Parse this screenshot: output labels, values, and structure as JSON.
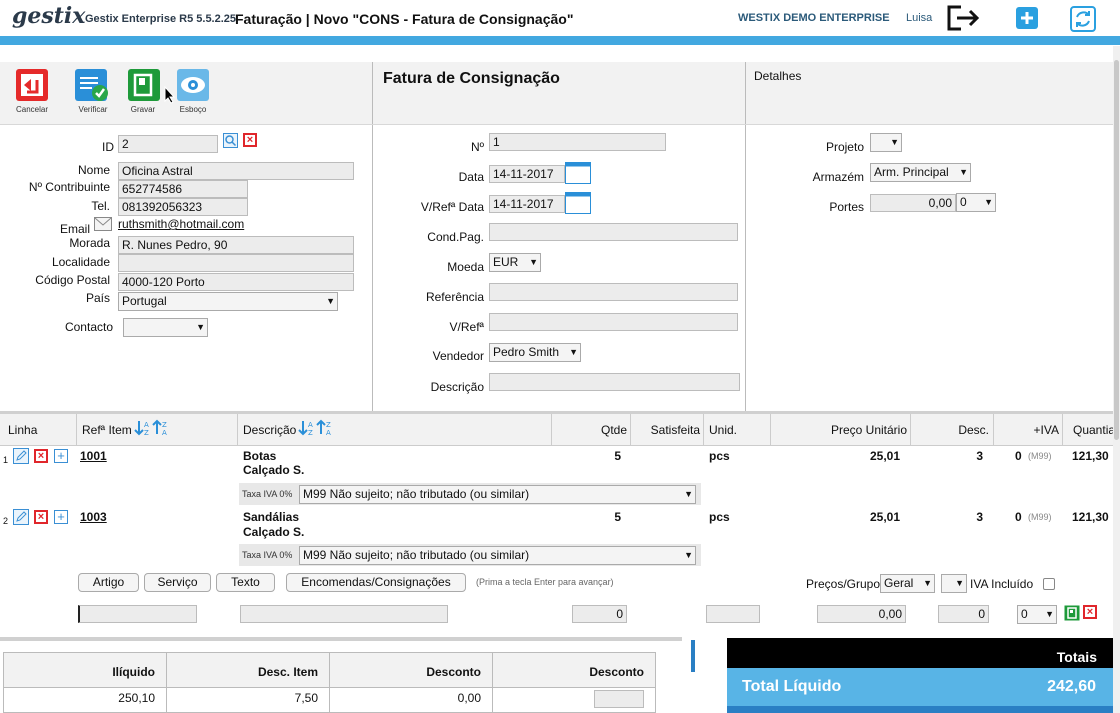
{
  "header": {
    "logo": "gestix",
    "version": "Gestix Enterprise R5 5.5.2.25",
    "title": "Faturação | Novo \"CONS - Fatura de Consignação\"",
    "company": "WESTIX DEMO ENTERPRISE",
    "user": "Luisa"
  },
  "toolbar": {
    "cancel": "Cancelar",
    "verify": "Verificar",
    "save": "Gravar",
    "draft": "Esboço"
  },
  "doc": {
    "title": "Fatura de Consignação",
    "details_title": "Detalhes"
  },
  "client": {
    "id_label": "ID",
    "id_value": "2",
    "name_label": "Nome",
    "name_value": "Oficina Astral",
    "nif_label": "Nº Contribuinte",
    "nif_value": "652774586",
    "phone_label": "Tel.",
    "phone_value": "081392056323",
    "email_label": "Email",
    "email_value": "ruthsmith@hotmail.com",
    "address_label": "Morada",
    "address_value": "R. Nunes Pedro, 90",
    "locality_label": "Localidade",
    "locality_value": "",
    "postal_label": "Código Postal",
    "postal_value": "4000-120 Porto",
    "country_label": "País",
    "country_value": "Portugal",
    "contact_label": "Contacto",
    "contact_value": ""
  },
  "invoice": {
    "number_label": "Nº",
    "number_value": "1",
    "date_label": "Data",
    "date_value": "14-11-2017",
    "ref_date_label": "V/Refª Data",
    "ref_date_value": "14-11-2017",
    "payment_label": "Cond.Pag.",
    "currency_label": "Moeda",
    "currency_value": "EUR",
    "reference_label": "Referência",
    "vref_label": "V/Refª",
    "seller_label": "Vendedor",
    "seller_value": "Pedro Smith",
    "description_label": "Descrição"
  },
  "details": {
    "project_label": "Projeto",
    "project_value": "",
    "warehouse_label": "Armazém",
    "warehouse_value": "Arm. Principal",
    "shipping_label": "Portes",
    "shipping_value": "0,00",
    "shipping_rate": "0"
  },
  "grid": {
    "headers": {
      "line": "Linha",
      "ref": "Refª Item",
      "desc": "Descrição",
      "qty": "Qtde",
      "satisfied": "Satisfeita",
      "unit": "Unid.",
      "price": "Preço Unitário",
      "discount": "Desc.",
      "vat": "+IVA",
      "amount": "Quantia"
    },
    "rows": [
      {
        "num": "1",
        "ref": "1001",
        "desc1": "Botas",
        "desc2": "Calçado S.",
        "qty": "5",
        "unit": "pcs",
        "price": "25,01",
        "discount": "3",
        "vat": "0",
        "vat_code": "(M99)",
        "amount": "121,30",
        "tax_label": "Taxa IVA 0%",
        "tax_value": "M99 Não sujeito; não tributado (ou similar)"
      },
      {
        "num": "2",
        "ref": "1003",
        "desc1": "Sandálias",
        "desc2": "Calçado S.",
        "qty": "5",
        "unit": "pcs",
        "price": "25,01",
        "discount": "3",
        "vat": "0",
        "vat_code": "(M99)",
        "amount": "121,30",
        "tax_label": "Taxa IVA 0%",
        "tax_value": "M99 Não sujeito; não tributado (ou similar)"
      }
    ],
    "buttons": {
      "article": "Artigo",
      "service": "Serviço",
      "text": "Texto",
      "orders": "Encomendas/Consignações",
      "hint": "(Prima a tecla Enter para avançar)"
    },
    "prices_group_label": "Preços/Grupo",
    "prices_group_value": "Geral",
    "vat_included_label": "IVA Incluído",
    "entry": {
      "qty": "0",
      "price": "0,00",
      "discount": "0",
      "vat": "0"
    }
  },
  "footer": {
    "headers": [
      "Ilíquido",
      "Desc. Item",
      "Desconto",
      "Desconto"
    ],
    "values": [
      "250,10",
      "7,50",
      "0,00",
      ""
    ],
    "totals_title": "Totais",
    "net_total_label": "Total Líquido",
    "net_total_value": "242,60"
  },
  "colors": {
    "accent": "#42a8e0",
    "totals_bar": "#58b4e6",
    "danger": "#e0262b",
    "save_green": "#1e9a3a"
  }
}
